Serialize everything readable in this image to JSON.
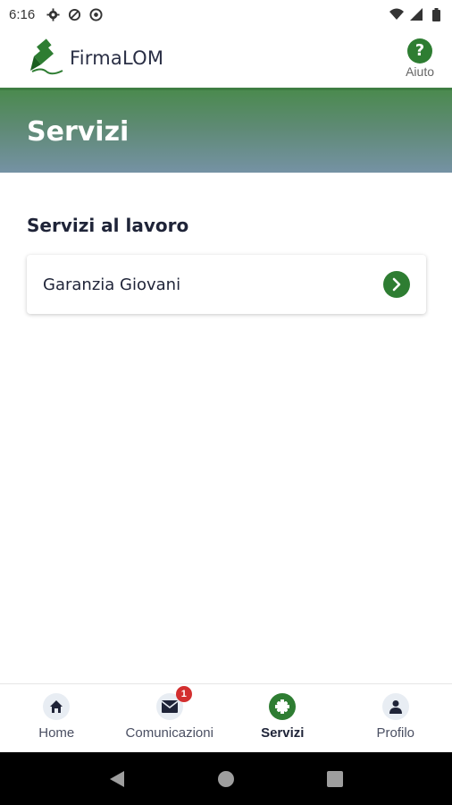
{
  "status_bar": {
    "time": "6:16",
    "icons_left": [
      "settings-icon",
      "data-saver-icon",
      "do-not-disturb-icon"
    ],
    "icons_right": [
      "wifi-icon",
      "signal-icon",
      "battery-icon"
    ]
  },
  "app_bar": {
    "logo_text": "FirmaLOM",
    "help_symbol": "?",
    "help_label": "Aiuto"
  },
  "header": {
    "title": "Servizi"
  },
  "main": {
    "section_title": "Servizi al lavoro",
    "services": [
      {
        "label": "Garanzia Giovani",
        "icon": "chevron-right-icon"
      }
    ]
  },
  "bottom_nav": {
    "items": [
      {
        "label": "Home",
        "icon": "home-icon",
        "active": false
      },
      {
        "label": "Comunicazioni",
        "icon": "mail-icon",
        "active": false,
        "badge": "1"
      },
      {
        "label": "Servizi",
        "icon": "services-icon",
        "active": true
      },
      {
        "label": "Profilo",
        "icon": "user-icon",
        "active": false
      }
    ]
  },
  "system_nav": {
    "buttons": [
      "back-icon",
      "home-circle-icon",
      "recents-icon"
    ]
  },
  "colors": {
    "brand_green": "#2e7d32",
    "banner_top": "#4b8a4f",
    "banner_bottom": "#7592a4",
    "badge_red": "#d32f2f",
    "text_dark": "#1f2438"
  }
}
